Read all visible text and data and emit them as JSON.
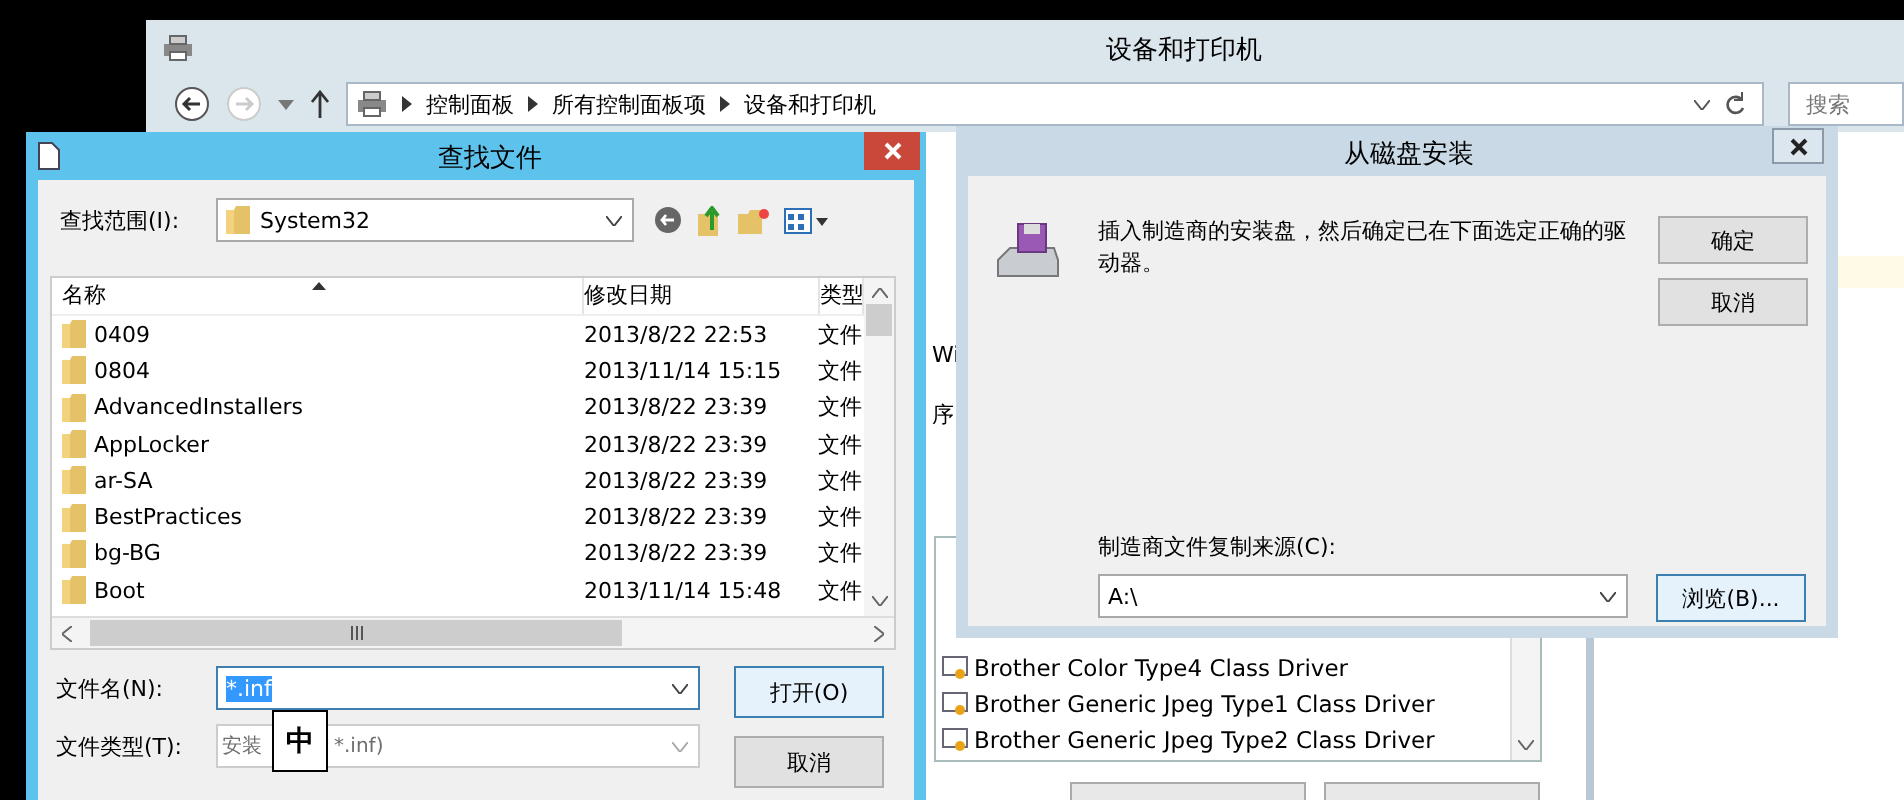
{
  "background_window": {
    "title": "设备和打印机",
    "breadcrumb": [
      "控制面板",
      "所有控制面板项",
      "设备和打印机"
    ],
    "search_placeholder": "搜索"
  },
  "wizard_window": {
    "fragments": [
      "Wi",
      "序"
    ],
    "drivers": [
      {
        "name": "Brother Color Type4 Class Driver"
      },
      {
        "name": "Brother Generic Jpeg Type1 Class Driver"
      },
      {
        "name": "Brother Generic Jpeg Type2 Class Driver"
      }
    ]
  },
  "find_dialog": {
    "title": "查找文件",
    "look_in_label": "查找范围(I):",
    "look_in_value": "System32",
    "columns": [
      "名称",
      "修改日期",
      "类型"
    ],
    "rows": [
      {
        "name": "0409",
        "modified": "2013/8/22 22:53",
        "type": "文件"
      },
      {
        "name": "0804",
        "modified": "2013/11/14 15:15",
        "type": "文件"
      },
      {
        "name": "AdvancedInstallers",
        "modified": "2013/8/22 23:39",
        "type": "文件"
      },
      {
        "name": "AppLocker",
        "modified": "2013/8/22 23:39",
        "type": "文件"
      },
      {
        "name": "ar-SA",
        "modified": "2013/8/22 23:39",
        "type": "文件"
      },
      {
        "name": "BestPractices",
        "modified": "2013/8/22 23:39",
        "type": "文件"
      },
      {
        "name": "bg-BG",
        "modified": "2013/8/22 23:39",
        "type": "文件"
      },
      {
        "name": "Boot",
        "modified": "2013/11/14 15:48",
        "type": "文件"
      }
    ],
    "file_name": {
      "label": "文件名(N):",
      "value": "*.inf",
      "value_selected": true
    },
    "file_type": {
      "label": "文件类型(T):",
      "value_parts": [
        "安装",
        "*.inf)"
      ],
      "disabled": true
    },
    "buttons": [
      "打开(O)",
      "取消"
    ]
  },
  "ime_indicator": "中",
  "install_dialog": {
    "title": "从磁盘安装",
    "message": "插入制造商的安装盘，然后确定已在下面选定正确的驱动器。",
    "buttons": [
      "确定",
      "取消"
    ],
    "source_label": "制造商文件复制来源(C):",
    "source_value": "A:\\",
    "browse_button": "浏览(B)..."
  }
}
